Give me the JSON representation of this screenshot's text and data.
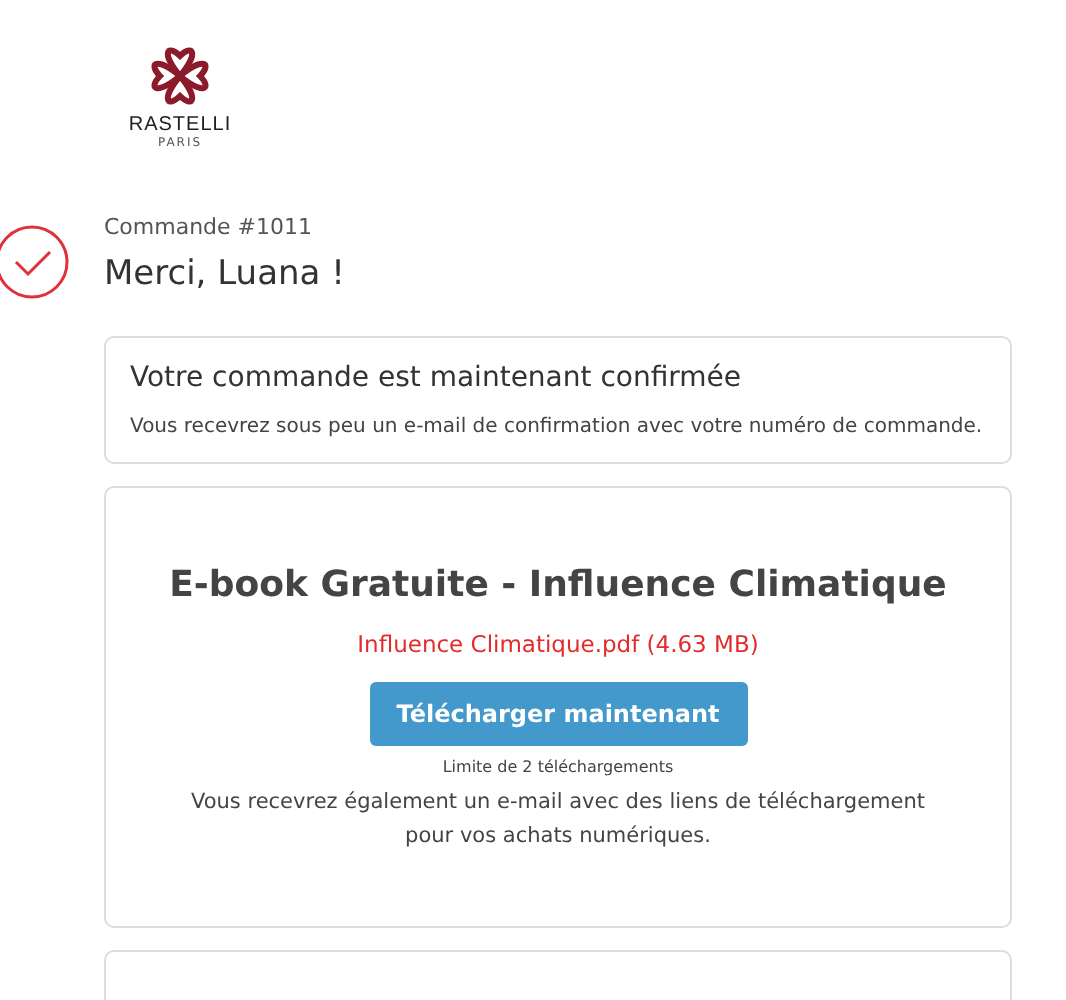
{
  "logo": {
    "brand": "RASTELLI",
    "tagline": "PARIS"
  },
  "order": {
    "number": "Commande #1011",
    "greeting": "Merci, Luana !",
    "confirmed": true
  },
  "confirmation": {
    "title": "Votre commande est maintenant confirmée",
    "text": "Vous recevrez sous peu un e-mail de confirmation avec votre numéro de commande."
  },
  "download": {
    "title": "E-book Gratuite - Influence Climatique",
    "file": "Influence Climatique.pdf (4.63 MB)",
    "button": "Télécharger maintenant",
    "limit": "Limite de 2 téléchargements",
    "note": "Vous recevrez également un e-mail avec des liens de téléchargement pour vos achats numériques."
  }
}
